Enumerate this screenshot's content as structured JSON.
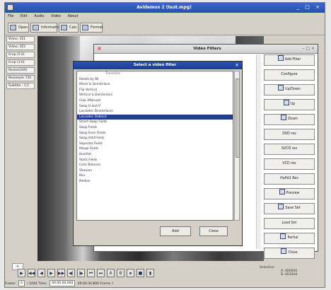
{
  "window": {
    "title": "Avidemux 2 (test.mpg)",
    "controls": "_ □ ×"
  },
  "menu": [
    "File",
    "Edit",
    "Audio",
    "Video",
    "About"
  ],
  "toolbar": {
    "buttons": [
      "Open",
      "Information",
      "Calc",
      "Format"
    ]
  },
  "left_panel": {
    "items": [
      "Video: 351",
      "Video: 352",
      "Crop (5.0)",
      "Crop (3.0)",
      "Resize(240)",
      "Resample 720",
      "Subtitle : 1,5"
    ]
  },
  "video_filters": {
    "title": "Video Filters",
    "close": "×",
    "controls": "– □ ×",
    "buttons": [
      "Add Filter",
      "Configure",
      "Up/Down",
      "Up",
      "Down",
      "DVD res",
      "SVCD res",
      "VCD res",
      "Halfd1 Res",
      "Preview",
      "Save Set",
      "Load Set",
      "Partial",
      "Close"
    ]
  },
  "select_filter_dialog": {
    "title": "Select a video filter",
    "close": "×",
    "list_items": [
      "Transform",
      "Rotate by 90",
      "Mirror & Deinterlace",
      "Flip Vertical",
      "Vertical & Deinterlace",
      "Crop (Manual)",
      "Swap U and V",
      "Lavcodec Deinterlacer",
      "Lavcodec Deblock",
      "Smart Swap Fields",
      "Swap Fields",
      "Swap Even Fields",
      "Swap Odd Fields",
      "Separate Fields",
      "Merge Fields",
      "Hue/Sat",
      "Stack Fields",
      "Color Balance",
      "Sharpen",
      "Blur",
      "Median"
    ],
    "selected_index": 8,
    "apply": "Add",
    "cancel": "Close"
  },
  "bottom": {
    "tab": "A",
    "nav_glyphs": [
      "▶",
      "◀◀",
      "◀",
      "▶",
      "▶▶",
      "◀|",
      "|▶",
      "⏮",
      "⏭",
      "A",
      "B",
      "⏹",
      "■",
      "▮"
    ],
    "frame_label": "Frame:",
    "frame_value": "0",
    "total_label": "/ 1044",
    "time_label": "Time:",
    "time_value": "00:00:00.000",
    "duration": "00:00:34.800",
    "frame_type": "Frame: I",
    "selection_title": "Selection",
    "selection_a": "A: 000000",
    "selection_b": "B: 001044"
  }
}
